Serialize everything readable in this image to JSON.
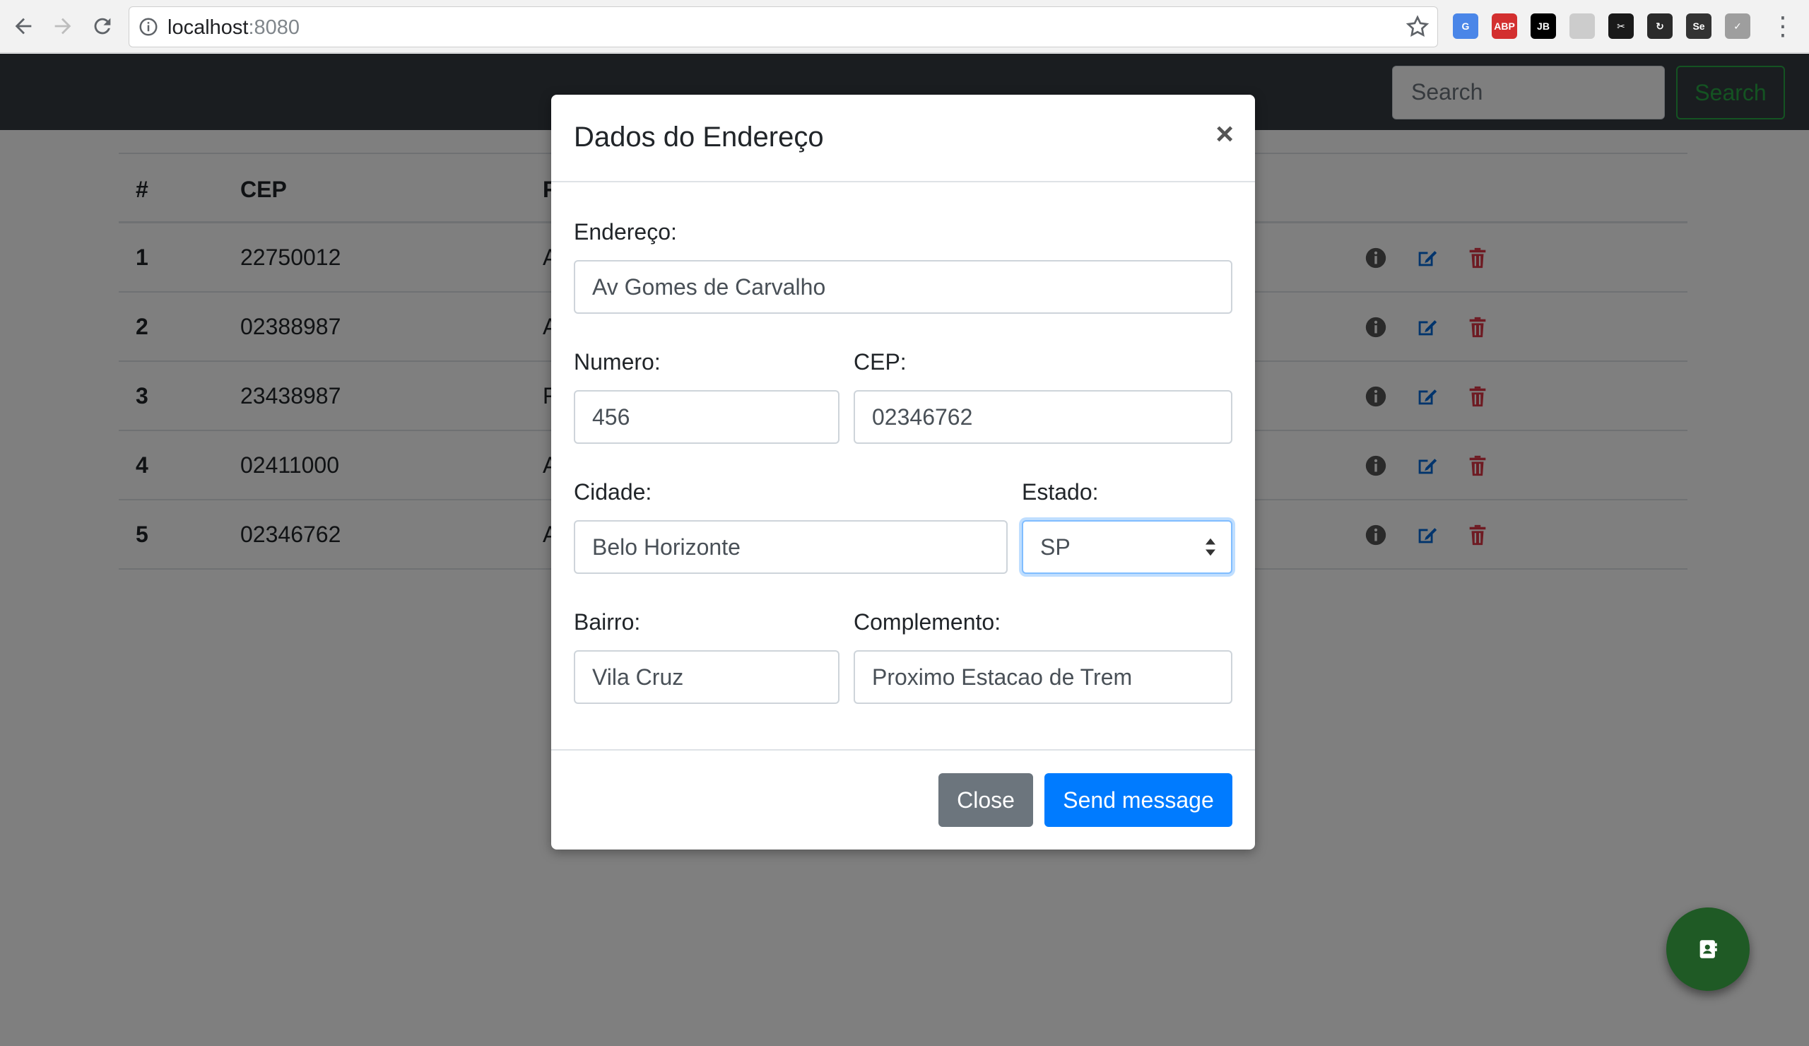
{
  "browser": {
    "url_host": "localhost",
    "url_port": ":8080",
    "extensions": [
      {
        "name": "translate-icon",
        "label": "G",
        "color": "#4a86e8"
      },
      {
        "name": "adblock-icon",
        "label": "ABP",
        "color": "#d32f2f"
      },
      {
        "name": "jetbrains-icon",
        "label": "JB",
        "color": "#000000"
      },
      {
        "name": "extension-icon",
        "label": "",
        "color": "#cccccc"
      },
      {
        "name": "scissors-icon",
        "label": "✂",
        "color": "#1a1a1a"
      },
      {
        "name": "refresh-extension-icon",
        "label": "↻",
        "color": "#2a2a2a"
      },
      {
        "name": "selenium-icon",
        "label": "Se",
        "color": "#333333"
      },
      {
        "name": "check-extension-icon",
        "label": "✓",
        "color": "#9e9e9e"
      }
    ]
  },
  "navbar": {
    "search_placeholder": "Search",
    "search_button": "Search"
  },
  "table": {
    "headers": [
      "#",
      "CEP",
      "F"
    ],
    "rows": [
      {
        "num": "1",
        "cep": "22750012",
        "partial": "A"
      },
      {
        "num": "2",
        "cep": "02388987",
        "partial": "A"
      },
      {
        "num": "3",
        "cep": "23438987",
        "partial": "F"
      },
      {
        "num": "4",
        "cep": "02411000",
        "partial": "A"
      },
      {
        "num": "5",
        "cep": "02346762",
        "partial": "A"
      }
    ]
  },
  "colors": {
    "info": "#555555",
    "edit": "#0069d9",
    "delete": "#dc3545",
    "fab": "#1f5a25"
  },
  "modal": {
    "title": "Dados do Endereço",
    "close_glyph": "×",
    "fields": {
      "endereco": {
        "label": "Endereço:",
        "value": "Av Gomes de Carvalho"
      },
      "numero": {
        "label": "Numero:",
        "value": "456"
      },
      "cep": {
        "label": "CEP:",
        "value": "02346762"
      },
      "cidade": {
        "label": "Cidade:",
        "value": "Belo Horizonte"
      },
      "estado": {
        "label": "Estado:",
        "value": "SP"
      },
      "bairro": {
        "label": "Bairro:",
        "value": "Vila Cruz"
      },
      "complemento": {
        "label": "Complemento:",
        "value": "Proximo Estacao de Trem"
      }
    },
    "close_button": "Close",
    "send_button": "Send message"
  }
}
